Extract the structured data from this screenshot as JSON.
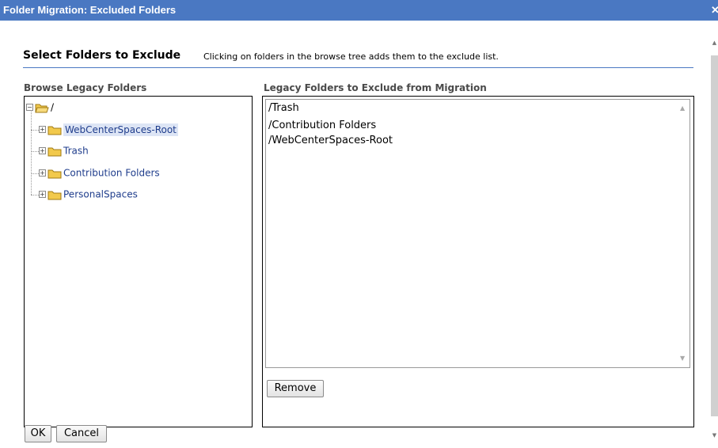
{
  "window": {
    "title": "Folder Migration: Excluded Folders",
    "close_glyph": "✕"
  },
  "header": {
    "title": "Select Folders to Exclude",
    "description": "Clicking on folders in the browse tree adds them to the exclude list."
  },
  "browse": {
    "label": "Browse Legacy Folders",
    "root_label": "/",
    "items": [
      {
        "label": "WebCenterSpaces-Root",
        "selected": true
      },
      {
        "label": "Trash",
        "selected": false
      },
      {
        "label": "Contribution Folders",
        "selected": false
      },
      {
        "label": "PersonalSpaces",
        "selected": false
      }
    ]
  },
  "exclude": {
    "label": "Legacy Folders to Exclude from Migration",
    "items": [
      "/Trash",
      "/Contribution Folders",
      "/WebCenterSpaces-Root"
    ],
    "remove_label": "Remove"
  },
  "footer": {
    "ok_label": "OK",
    "cancel_label": "Cancel"
  },
  "colors": {
    "titlebar": "#4a78c2",
    "link": "#1f3d8c",
    "folder": "#f2c94c"
  },
  "icons": {
    "collapse": "minus-square-icon",
    "expand": "plus-square-icon",
    "folder": "folder-icon",
    "folder_open": "folder-open-icon"
  }
}
